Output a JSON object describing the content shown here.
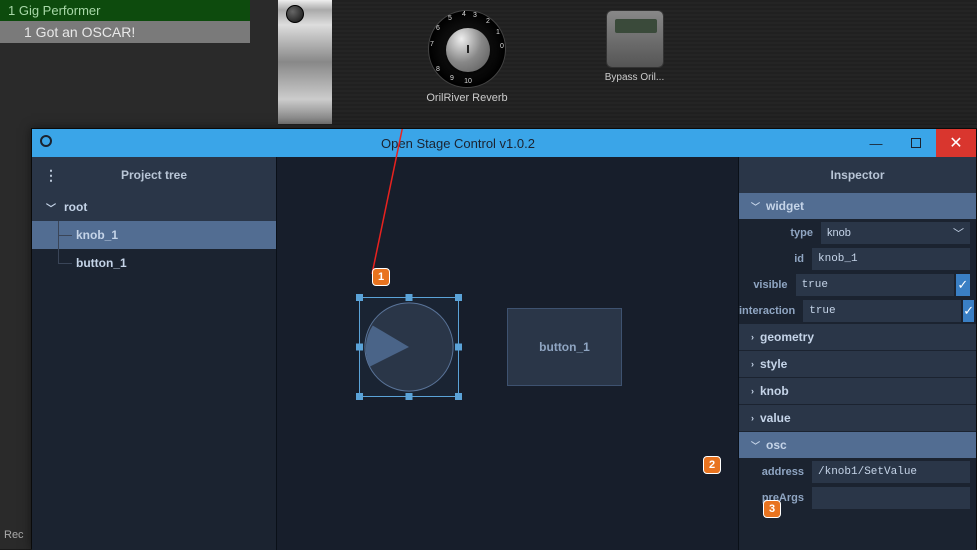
{
  "gig": {
    "title": "1 Gig Performer",
    "subtitle": "1  Got an OSCAR!",
    "rec": "Rec"
  },
  "plugins": {
    "knob_label": "OrilRiver Reverb",
    "bypass_label": "Bypass Oril...",
    "dial": [
      "0",
      "1",
      "2",
      "3",
      "4",
      "5",
      "6",
      "7",
      "8",
      "9",
      "10"
    ]
  },
  "osc": {
    "title": "Open Stage Control v1.0.2"
  },
  "tree": {
    "title": "Project tree",
    "root": "root",
    "items": [
      "knob_1",
      "button_1"
    ]
  },
  "canvas": {
    "button_label": "button_1"
  },
  "inspector": {
    "title": "Inspector",
    "sections": {
      "widget": "widget",
      "geometry": "geometry",
      "style": "style",
      "knob": "knob",
      "value": "value",
      "osc": "osc"
    },
    "widget_props": {
      "type_label": "type",
      "type_value": "knob",
      "id_label": "id",
      "id_value": "knob_1",
      "visible_label": "visible",
      "visible_value": "true",
      "interaction_label": "interaction",
      "interaction_value": "true"
    },
    "osc_props": {
      "address_label": "address",
      "address_value": "/knob1/SetValue",
      "preargs_label": "preArgs"
    }
  },
  "annotations": {
    "a1": "1",
    "a2": "2",
    "a3": "3"
  }
}
